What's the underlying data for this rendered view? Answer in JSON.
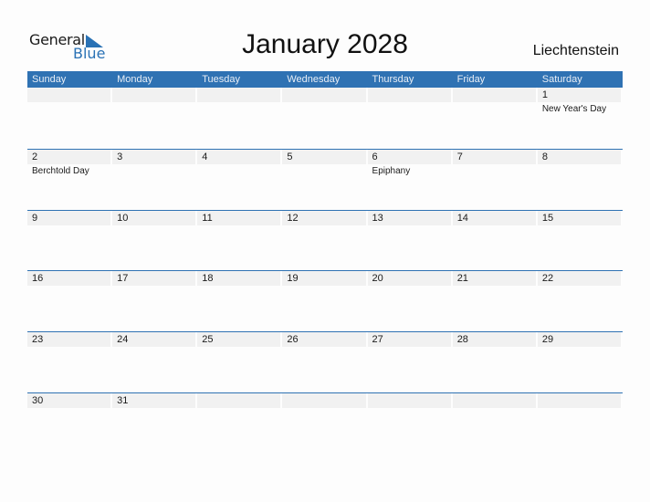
{
  "logo": {
    "word1": "General",
    "word2": "Blue"
  },
  "title": "January 2028",
  "country": "Liechtenstein",
  "colors": {
    "accent": "#2f72b3",
    "cell_strip": "#f1f1f1"
  },
  "weekdays": [
    "Sunday",
    "Monday",
    "Tuesday",
    "Wednesday",
    "Thursday",
    "Friday",
    "Saturday"
  ],
  "weeks": [
    [
      {
        "day": "",
        "holiday": ""
      },
      {
        "day": "",
        "holiday": ""
      },
      {
        "day": "",
        "holiday": ""
      },
      {
        "day": "",
        "holiday": ""
      },
      {
        "day": "",
        "holiday": ""
      },
      {
        "day": "",
        "holiday": ""
      },
      {
        "day": "1",
        "holiday": "New Year's Day"
      }
    ],
    [
      {
        "day": "2",
        "holiday": "Berchtold Day"
      },
      {
        "day": "3",
        "holiday": ""
      },
      {
        "day": "4",
        "holiday": ""
      },
      {
        "day": "5",
        "holiday": ""
      },
      {
        "day": "6",
        "holiday": "Epiphany"
      },
      {
        "day": "7",
        "holiday": ""
      },
      {
        "day": "8",
        "holiday": ""
      }
    ],
    [
      {
        "day": "9",
        "holiday": ""
      },
      {
        "day": "10",
        "holiday": ""
      },
      {
        "day": "11",
        "holiday": ""
      },
      {
        "day": "12",
        "holiday": ""
      },
      {
        "day": "13",
        "holiday": ""
      },
      {
        "day": "14",
        "holiday": ""
      },
      {
        "day": "15",
        "holiday": ""
      }
    ],
    [
      {
        "day": "16",
        "holiday": ""
      },
      {
        "day": "17",
        "holiday": ""
      },
      {
        "day": "18",
        "holiday": ""
      },
      {
        "day": "19",
        "holiday": ""
      },
      {
        "day": "20",
        "holiday": ""
      },
      {
        "day": "21",
        "holiday": ""
      },
      {
        "day": "22",
        "holiday": ""
      }
    ],
    [
      {
        "day": "23",
        "holiday": ""
      },
      {
        "day": "24",
        "holiday": ""
      },
      {
        "day": "25",
        "holiday": ""
      },
      {
        "day": "26",
        "holiday": ""
      },
      {
        "day": "27",
        "holiday": ""
      },
      {
        "day": "28",
        "holiday": ""
      },
      {
        "day": "29",
        "holiday": ""
      }
    ],
    [
      {
        "day": "30",
        "holiday": ""
      },
      {
        "day": "31",
        "holiday": ""
      },
      {
        "day": "",
        "holiday": ""
      },
      {
        "day": "",
        "holiday": ""
      },
      {
        "day": "",
        "holiday": ""
      },
      {
        "day": "",
        "holiday": ""
      },
      {
        "day": "",
        "holiday": ""
      }
    ]
  ]
}
